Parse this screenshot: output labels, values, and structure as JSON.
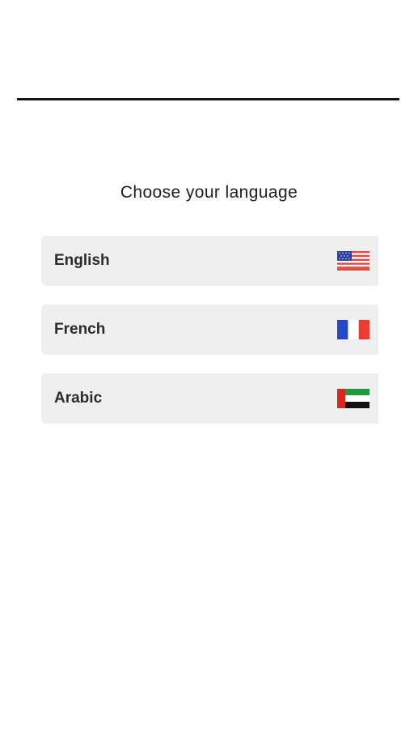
{
  "title": "Choose your language",
  "languages": [
    {
      "label": "English",
      "flag_icon": "us-flag-icon"
    },
    {
      "label": "French",
      "flag_icon": "fr-flag-icon"
    },
    {
      "label": "Arabic",
      "flag_icon": "ae-flag-icon"
    }
  ],
  "colors": {
    "background": "#ffffff",
    "item_background": "#efefef",
    "header_rule": "#141414",
    "text": "#2b2b2b"
  }
}
